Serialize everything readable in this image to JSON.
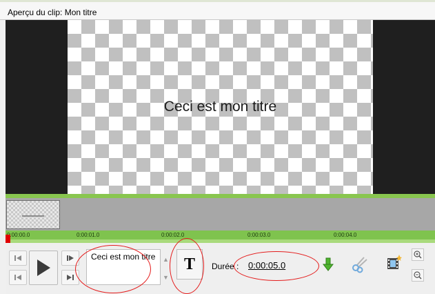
{
  "window": {
    "title": "Aperçu du clip: Mon titre"
  },
  "preview": {
    "overlay_text": "Ceci est mon titre"
  },
  "timeline": {
    "ticks": [
      "0:00:00.0",
      "0:00:01.0",
      "0:00:02.0",
      "0:00:03.0",
      "0:00:04.0"
    ]
  },
  "controls": {
    "title_text": "Ceci est mon titre",
    "title_button_label": "T",
    "duration_label": "Durée :",
    "duration_value": "0:00:05.0"
  },
  "icons": {
    "prev_frame": "skip-back-icon",
    "to_start": "go-to-start-icon",
    "play": "play-icon",
    "next_frame": "step-forward-icon",
    "to_end": "go-to-end-icon",
    "add_down": "green-down-arrow-icon",
    "cut": "scissors-icon",
    "add_clip": "film-star-icon",
    "zoom_in": "zoom-in-icon",
    "zoom_out": "zoom-out-icon"
  },
  "colors": {
    "accent_green": "#7fc34e",
    "highlight_red": "#e41b1b",
    "playhead": "#e00000"
  }
}
